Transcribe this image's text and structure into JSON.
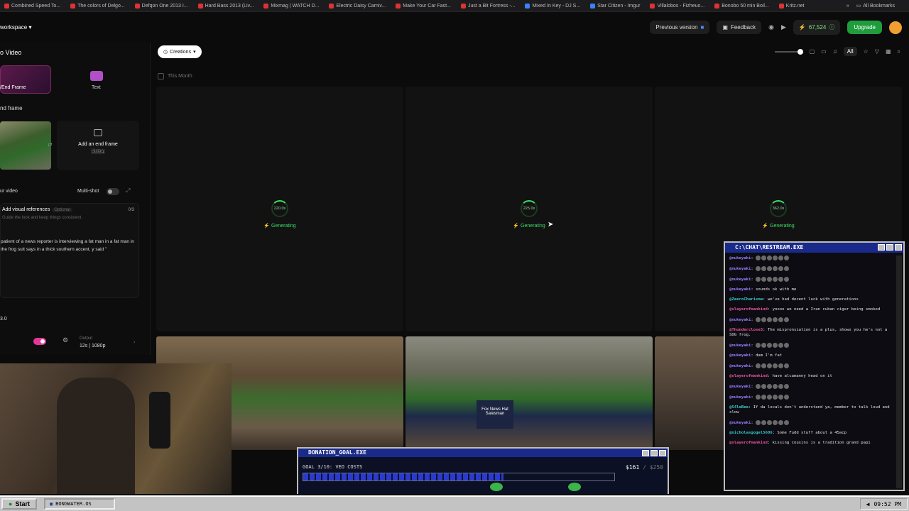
{
  "bookmarks": [
    {
      "label": "Combined Speed To..."
    },
    {
      "label": "The colors of Delgo..."
    },
    {
      "label": "Defqon One 2013 I..."
    },
    {
      "label": "Hard Bass 2013 (Liv..."
    },
    {
      "label": "Mixmag | WATCH D..."
    },
    {
      "label": "Electric Daisy Carniv..."
    },
    {
      "label": "Make Your Car Fast..."
    },
    {
      "label": "Just a Bit Fortress -..."
    },
    {
      "label": "Mixed In Key - DJ S..."
    },
    {
      "label": "Star Citizen - Imgur"
    },
    {
      "label": "Villalobos - Fizheuo..."
    },
    {
      "label": "Bonobo 50 min Boil..."
    },
    {
      "label": "Kritz.net"
    }
  ],
  "all_bookmarks_label": "All Bookmarks",
  "header": {
    "workspace": "workspace",
    "previous_version": "Previous version",
    "feedback": "Feedback",
    "credits": "67,524",
    "upgrade": "Upgrade"
  },
  "left_panel": {
    "title": "o Video",
    "tab_frame": "/End Frame",
    "tab_text": "Text",
    "end_frame_label": "nd frame",
    "add_end_frame": "Add an end frame",
    "history": "History",
    "your_video": "ur video",
    "multi_shot": "Multi-shot",
    "add_visual_refs": "Add visual references",
    "optional": "Optional",
    "refs_hint": "Guide the look and keep things consistent.",
    "refs_count": "0/3",
    "prompt": "patient of a news reporter is interviewing a fat man in a fat man in the frog suit says in a thick southern accent, y said \"",
    "model": "3.0",
    "output_label": "Output",
    "output_value": "12s | 1080p"
  },
  "main": {
    "creations": "Creations",
    "all": "All",
    "this_month": "This Month",
    "cards": [
      {
        "time": "220.0s",
        "status": "Generating"
      },
      {
        "time": "225.0s",
        "status": "Generating"
      },
      {
        "time": "362.0s",
        "status": "Generating"
      }
    ],
    "shirt_text": "Fox News Hat Salesman"
  },
  "chat": {
    "title": "C:\\CHAT\\RESTREAM.EXE",
    "messages": [
      {
        "user": "@nukeyaki",
        "text": ""
      },
      {
        "user": "@nukeyaki",
        "text": ""
      },
      {
        "user": "@nukeyaki",
        "text": ""
      },
      {
        "user": "@nukeyaki",
        "text": "sounds ok with me"
      },
      {
        "user": "@ZeeroCharisma",
        "text": "we've had decent luck with generations"
      },
      {
        "user": "@slayerofmankind",
        "text": "yoooo we need a Iran cuban cigar being smoked"
      },
      {
        "user": "@nukeyaki",
        "text": ""
      },
      {
        "user": "@Thunderclose3",
        "text": "The mispronsiation is a plus, shows you he's not a SOG frog."
      },
      {
        "user": "@nukeyaki",
        "text": ""
      },
      {
        "user": "@nukeyaki",
        "text": "dam I'm fat"
      },
      {
        "user": "@nukeyaki",
        "text": ""
      },
      {
        "user": "@slayerofmankind",
        "text": "have alcamanny head on it"
      },
      {
        "user": "@nukeyaki",
        "text": ""
      },
      {
        "user": "@nukeyaki",
        "text": ""
      },
      {
        "user": "@S4leBee",
        "text": "If da locals don't understand ya, member to talk loud and slow"
      },
      {
        "user": "@nukeyaki",
        "text": ""
      },
      {
        "user": "@nicholasgogel5606",
        "text": "Some Fudd stuff about a 45acp"
      },
      {
        "user": "@slayerofmankind",
        "text": "kissing cousins is a tradition grand papi"
      }
    ]
  },
  "donation": {
    "title": "DONATION_GOAL.EXE",
    "goal": "GOAL 3/10: VEO COSTS",
    "raised": "$161",
    "target": "/ $250",
    "progress": 0.644
  },
  "taskbar": {
    "start": "Start",
    "task": "BONGWATER.OS",
    "clock": "09:52 PM"
  }
}
